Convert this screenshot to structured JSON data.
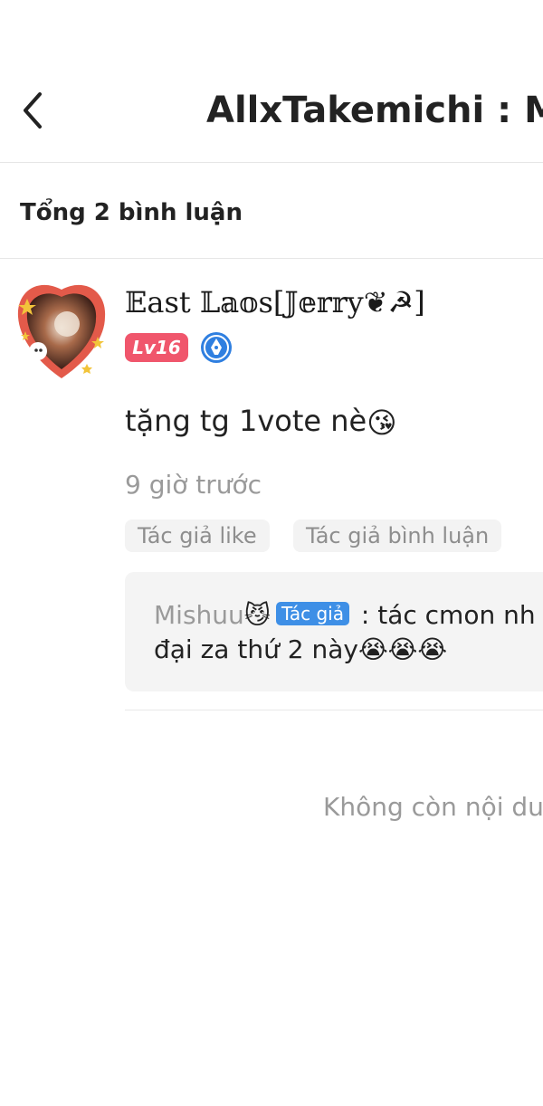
{
  "header": {
    "title": "AllxTakemichi : M"
  },
  "comments_summary": {
    "total_text": "Tổng 2 bình luận"
  },
  "comment": {
    "username": "𝔼ast 𝕃𝕒𝕠s[𝕁𝕖𝕣𝕣y❦☭]",
    "level": "Lv16",
    "text": "tặng tg 1vote nè",
    "text_emoji": "😘",
    "time": "9 giờ trước",
    "tags": {
      "author_like": "Tác giả like",
      "author_reply": "Tác giả bình luận"
    },
    "reply": {
      "name": "Mishuu",
      "name_emoji": "😼",
      "badge": "Tác giả",
      "separator": " : ",
      "content_line1": "tác cmon nh",
      "content_line2": "đại za thứ 2 này",
      "content_emojis": "😭😭😭"
    }
  },
  "footer": {
    "no_more_text": "Không còn nội du"
  },
  "colors": {
    "level_badge": "#f0566c",
    "author_badge": "#3e8fe6",
    "writer_icon": "#2f7fe0"
  },
  "icons": {
    "back": "chevron-left-icon",
    "writer": "writer-pen-icon"
  }
}
